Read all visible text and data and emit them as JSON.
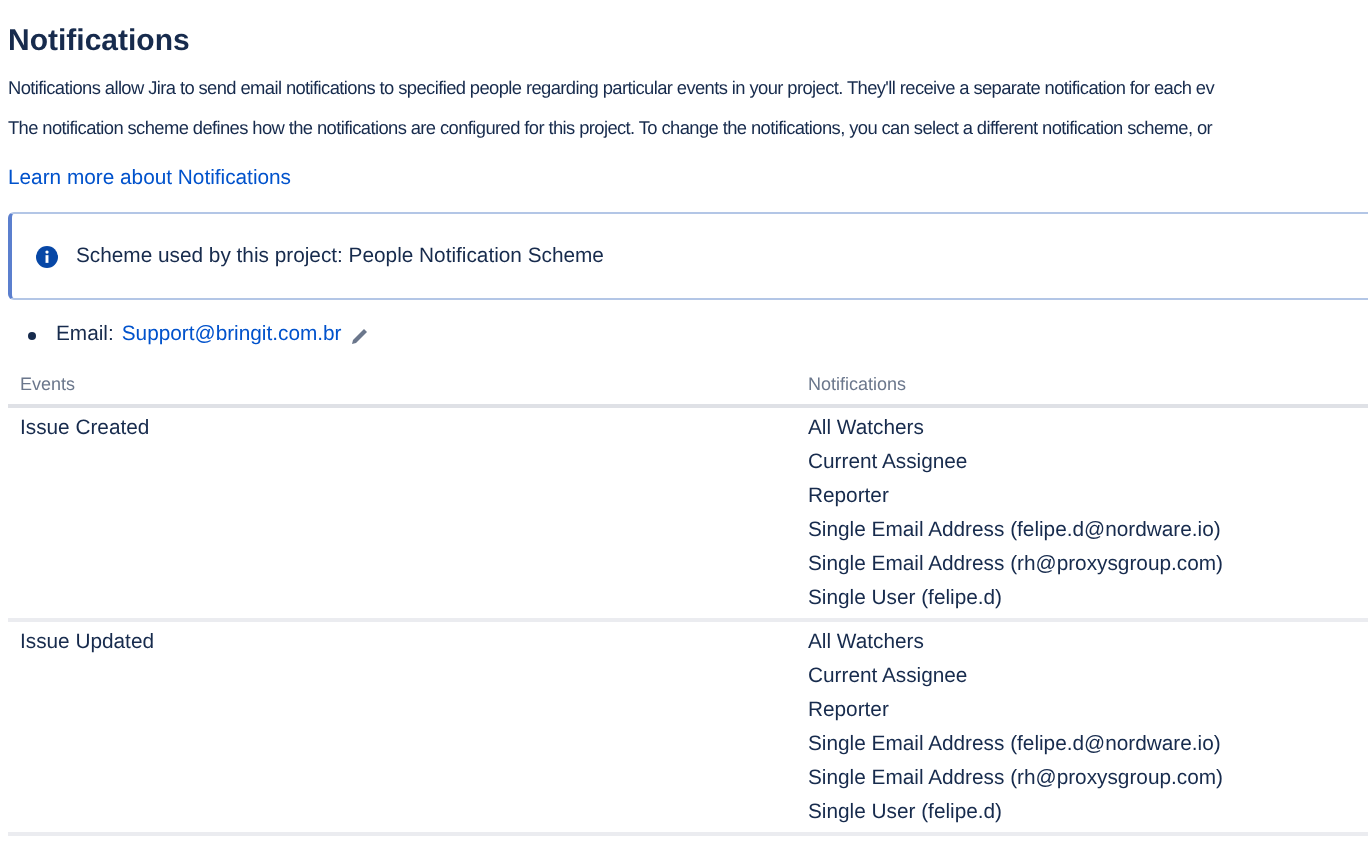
{
  "title": "Notifications",
  "paragraphs": [
    "Notifications allow Jira to send email notifications to specified people regarding particular events in your project. They'll receive a separate notification for each ev",
    "The notification scheme defines how the notifications are configured for this project. To change the notifications, you can select a different notification scheme, or"
  ],
  "learn_more_link": "Learn more about Notifications",
  "info_panel": {
    "text": "Scheme used by this project: People Notification Scheme"
  },
  "email": {
    "label": "Email:",
    "address": "Support@bringit.com.br"
  },
  "table": {
    "columns": [
      "Events",
      "Notifications"
    ],
    "rows": [
      {
        "event": "Issue Created",
        "notifications": [
          "All Watchers",
          "Current Assignee",
          "Reporter",
          "Single Email Address (felipe.d@nordware.io)",
          "Single Email Address (rh@proxysgroup.com)",
          "Single User (felipe.d)"
        ]
      },
      {
        "event": "Issue Updated",
        "notifications": [
          "All Watchers",
          "Current Assignee",
          "Reporter",
          "Single Email Address (felipe.d@nordware.io)",
          "Single Email Address (rh@proxysgroup.com)",
          "Single User (felipe.d)"
        ]
      }
    ]
  }
}
